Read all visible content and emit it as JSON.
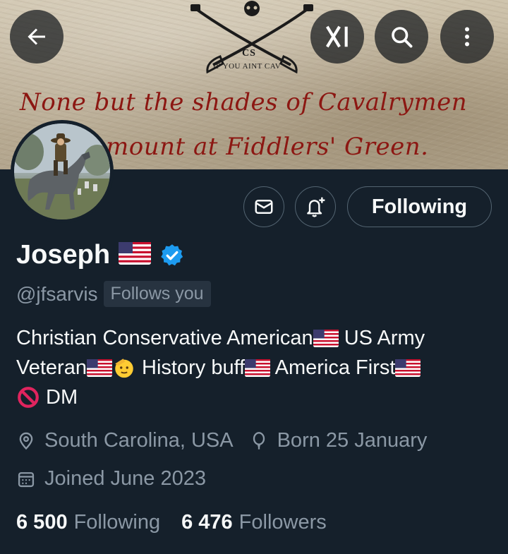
{
  "banner": {
    "cs_text": "CS",
    "motto": "IF YOU AINT CAV",
    "line1": "None but the shades of Cavalrymen",
    "line2": "mount at Fiddlers' Green."
  },
  "top_bar": {
    "back_icon": "arrow-left-icon",
    "grok_icon": "grok-logo-icon",
    "search_icon": "search-icon",
    "more_icon": "more-vertical-icon"
  },
  "profile": {
    "avatar_icon": "cavalryman-avatar",
    "name": "Joseph",
    "handle": "@jfsarvis",
    "follows_you": "Follows you",
    "verified_color": "#1d9bf0"
  },
  "actions": {
    "message_icon": "mail-icon",
    "notify_icon": "bell-plus-icon",
    "follow_label": "Following"
  },
  "bio": {
    "line1_a": "Christian Conservative American",
    "line1_b": " US Army",
    "line2_a": "Veteran",
    "line2_b": " History buff",
    "line2_c": " America First",
    "line3": " DM"
  },
  "meta": {
    "location": "South Carolina, USA",
    "birthday": "Born 25 January",
    "joined": "Joined June 2023"
  },
  "stats": {
    "following_count": "6 500",
    "following_label": "Following",
    "followers_count": "6 476",
    "followers_label": "Followers"
  },
  "colors": {
    "background": "#15202b",
    "secondary_text": "#8b98a5",
    "border": "#536471",
    "banner_text": "#8c1712"
  }
}
